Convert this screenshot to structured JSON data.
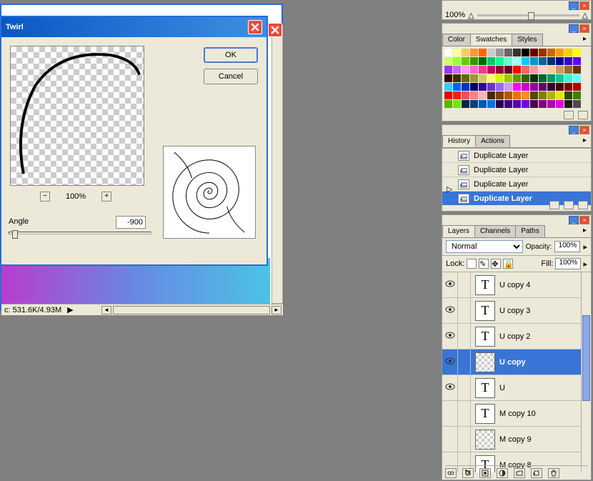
{
  "dialog": {
    "title": "Twirl",
    "ok": "OK",
    "cancel": "Cancel",
    "zoom": "100%",
    "angle_label": "Angle",
    "angle_value": "-900"
  },
  "doc": {
    "status": "c: 531.6K/4.93M"
  },
  "nav": {
    "zoom": "100%"
  },
  "swatches": {
    "tabs": [
      "Color",
      "Swatches",
      "Styles"
    ],
    "colors": [
      "#ffffff",
      "#ffff99",
      "#ffcc66",
      "#ff9933",
      "#ff6600",
      "#cccccc",
      "#999999",
      "#666666",
      "#333333",
      "#000000",
      "#660000",
      "#993300",
      "#cc6600",
      "#ff9900",
      "#ffcc00",
      "#ffff00",
      "#ccff66",
      "#99ff33",
      "#66cc00",
      "#339900",
      "#006600",
      "#00cc66",
      "#00ff99",
      "#66ffcc",
      "#99ffff",
      "#00ccff",
      "#0099cc",
      "#006699",
      "#003366",
      "#000099",
      "#3300cc",
      "#6600ff",
      "#9933ff",
      "#cc66ff",
      "#ff99ff",
      "#ff66cc",
      "#ff3399",
      "#cc0066",
      "#990033",
      "#660033",
      "#ff0000",
      "#ff6666",
      "#ff9999",
      "#ffcccc",
      "#ffcc99",
      "#cc9966",
      "#996633",
      "#663300",
      "#330000",
      "#333300",
      "#666600",
      "#999933",
      "#cccc66",
      "#ffff66",
      "#ccff00",
      "#99cc00",
      "#669900",
      "#336600",
      "#003300",
      "#006633",
      "#009966",
      "#00cc99",
      "#33ffcc",
      "#66ffff",
      "#33ccff",
      "#0066ff",
      "#0033cc",
      "#000066",
      "#330099",
      "#6633cc",
      "#9966ff",
      "#cc99ff",
      "#ff00ff",
      "#cc00cc",
      "#990099",
      "#660066",
      "#330033",
      "#4d0000",
      "#800000",
      "#b30000",
      "#e60000",
      "#ff1a1a",
      "#ff4d4d",
      "#ff8080",
      "#ffb3b3",
      "#4d2600",
      "#804000",
      "#b35900",
      "#e67300",
      "#ff8c1a",
      "#4d4d00",
      "#808000",
      "#b3b300",
      "#e6e600",
      "#264d00",
      "#408000",
      "#59b300",
      "#73e600",
      "#00264d",
      "#004080",
      "#0059b3",
      "#0073e6",
      "#26004d",
      "#400080",
      "#5900b3",
      "#7300e6",
      "#4d004d",
      "#800080",
      "#b300b3",
      "#e600e6",
      "#1a1a1a",
      "#4d4d4d"
    ]
  },
  "history": {
    "tabs": [
      "History",
      "Actions"
    ],
    "items": [
      "Duplicate Layer",
      "Duplicate Layer",
      "Duplicate Layer",
      "Duplicate Layer"
    ],
    "selected": 3
  },
  "layers": {
    "tabs": [
      "Layers",
      "Channels",
      "Paths"
    ],
    "blend": "Normal",
    "opacity_label": "Opacity:",
    "opacity": "100%",
    "lock_label": "Lock:",
    "fill_label": "Fill:",
    "fill": "100%",
    "items": [
      {
        "name": "U copy 4",
        "type": "T",
        "vis": true
      },
      {
        "name": "U copy 3",
        "type": "T",
        "vis": true
      },
      {
        "name": "U copy 2",
        "type": "T",
        "vis": true
      },
      {
        "name": "U copy",
        "type": "chk",
        "vis": true,
        "sel": true
      },
      {
        "name": "U",
        "type": "T",
        "vis": true
      },
      {
        "name": "M copy 10",
        "type": "T",
        "vis": false
      },
      {
        "name": "M copy 9",
        "type": "chk",
        "vis": false
      },
      {
        "name": "M copy 8",
        "type": "T",
        "vis": false
      }
    ]
  }
}
